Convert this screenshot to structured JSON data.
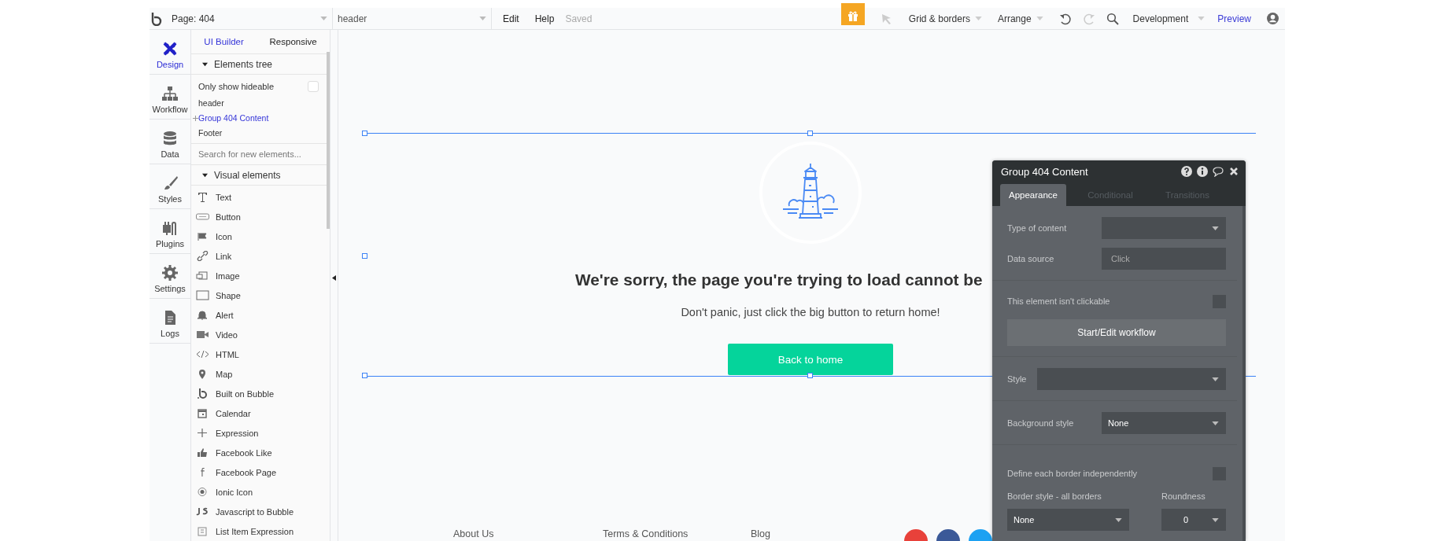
{
  "top_bar": {
    "page_select": "Page: 404",
    "element_select": "header",
    "menu": [
      "Edit",
      "Help"
    ],
    "save_status": "Saved",
    "grid_menu": "Grid & borders",
    "arrange_menu": "Arrange",
    "undo": {
      "disabled": false
    },
    "redo": {
      "disabled": true
    },
    "mode_select": "Development",
    "preview": "Preview"
  },
  "sidebar_tabs": [
    {
      "label": "Design",
      "selected": true
    },
    {
      "label": "Workflow",
      "selected": false
    },
    {
      "label": "Data",
      "selected": false
    },
    {
      "label": "Styles",
      "selected": false
    },
    {
      "label": "Plugins",
      "selected": false
    },
    {
      "label": "Settings",
      "selected": false
    },
    {
      "label": "Logs",
      "selected": false
    }
  ],
  "panel": {
    "tabs": [
      {
        "label": "UI Builder",
        "selected": true
      },
      {
        "label": "Responsive",
        "selected": false
      }
    ],
    "elements_tree": {
      "title": "Elements tree",
      "expanded": true,
      "filter": {
        "label": "Only show hideable",
        "checked": false
      },
      "items": [
        {
          "label": "header",
          "selected": false
        },
        {
          "label": "Group 404 Content",
          "selected": true
        },
        {
          "label": "Footer",
          "selected": false
        }
      ]
    },
    "search": {
      "placeholder": "Search for new elements..."
    },
    "visual_elements": {
      "title": "Visual elements",
      "expanded": true,
      "items": [
        "Text",
        "Button",
        "Icon",
        "Link",
        "Image",
        "Shape",
        "Alert",
        "Video",
        "HTML",
        "Map",
        "Built on Bubble",
        "Calendar",
        "Expression",
        "Facebook Like",
        "Facebook Page",
        "Ionic Icon",
        "Javascript to Bubble",
        "List Item Expression"
      ]
    }
  },
  "canvas": {
    "heading": "We're sorry, the page you're trying to load cannot be",
    "subtitle": "Don't panic, just click the big button to return home!",
    "button": "Back to home",
    "footer_links": [
      "About Us",
      "Terms & Conditions",
      "Blog"
    ],
    "social": [
      {
        "color": "#e8413a"
      },
      {
        "color": "#3b5998"
      },
      {
        "color": "#1da1f2"
      }
    ]
  },
  "property_editor": {
    "title": "Group 404 Content",
    "tabs": [
      {
        "label": "Appearance",
        "selected": true
      },
      {
        "label": "Conditional",
        "selected": false
      },
      {
        "label": "Transitions",
        "selected": false
      }
    ],
    "sections": [
      [
        {
          "kind": "dropdown",
          "label": "Type of content"
        },
        {
          "kind": "field",
          "label": "Data source",
          "placeholder": "Click"
        }
      ],
      [
        {
          "kind": "checkbox",
          "label": "This element isn't clickable",
          "checked": false
        },
        {
          "kind": "button",
          "label": "Start/Edit workflow"
        }
      ],
      [
        {
          "kind": "wide_dropdown",
          "label": "Style"
        }
      ],
      [
        {
          "kind": "dropdown",
          "label": "Background style",
          "value": "None"
        }
      ],
      [
        {
          "kind": "checkbox",
          "label": "Define each border independently",
          "checked": false
        },
        {
          "kind": "pair",
          "items": [
            {
              "label": "Border style - all borders",
              "value": "None"
            },
            {
              "label": "Roundness",
              "value": "0"
            }
          ]
        }
      ]
    ]
  }
}
